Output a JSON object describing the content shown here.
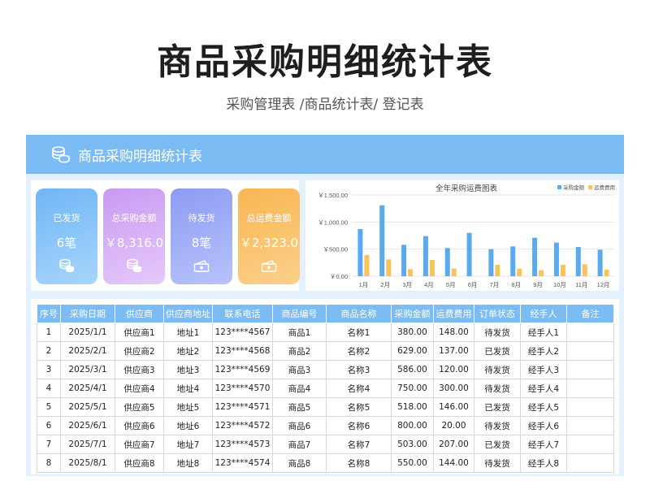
{
  "title": "商品采购明细统计表",
  "subtitle": "采购管理表 /商品统计表/ 登记表",
  "panel": {
    "header_title": "商品采购明细统计表",
    "header_icon": "coins-icon",
    "accent": "#7cbcf5"
  },
  "cards": [
    {
      "label": "已发货",
      "value": "6笔",
      "icon": "coins-icon",
      "color": "#6fb6f5"
    },
    {
      "label": "总采购金额",
      "value": "￥8,316.0",
      "icon": "coins-icon",
      "color": "#c89af2"
    },
    {
      "label": "待发货",
      "value": "8笔",
      "icon": "money-bill-icon",
      "color": "#8c9cf3"
    },
    {
      "label": "总运费金额",
      "value": "￥2,323.0",
      "icon": "money-bill-icon",
      "color": "#f9b651"
    }
  ],
  "chart_data": {
    "type": "bar",
    "title": "全年采购运费图表",
    "categories": [
      "1月",
      "2月",
      "3月",
      "4月",
      "5月",
      "6月",
      "7月",
      "8月",
      "9月",
      "10月",
      "11月",
      "12月"
    ],
    "series": [
      {
        "name": "采购金额",
        "color": "#5aaaf0",
        "values": [
          870,
          1310,
          580,
          740,
          520,
          800,
          500,
          550,
          710,
          620,
          540,
          490
        ]
      },
      {
        "name": "运费费用",
        "color": "#f8c35a",
        "values": [
          390,
          310,
          130,
          300,
          140,
          0,
          210,
          140,
          110,
          210,
          220,
          120
        ]
      }
    ],
    "y_ticks": [
      "￥1,500.00",
      "￥1,000.00",
      "￥500.00",
      "￥0.00"
    ],
    "ylim": [
      0,
      1500
    ],
    "legend_position": "top-right"
  },
  "table": {
    "headers": [
      "序号",
      "采购日期",
      "供应商",
      "供应商地址",
      "联系电话",
      "商品编号",
      "商品名称",
      "采购金额",
      "运费费用",
      "订单状态",
      "经手人",
      "备注"
    ],
    "rows": [
      [
        "1",
        "2025/1/1",
        "供应商1",
        "地址1",
        "123****4567",
        "商品1",
        "名称1",
        "380.00",
        "148.00",
        "待发货",
        "经手人1",
        ""
      ],
      [
        "2",
        "2025/2/1",
        "供应商2",
        "地址2",
        "123****4568",
        "商品2",
        "名称2",
        "629.00",
        "137.00",
        "已发货",
        "经手人2",
        ""
      ],
      [
        "3",
        "2025/3/1",
        "供应商3",
        "地址3",
        "123****4569",
        "商品3",
        "名称3",
        "586.00",
        "120.00",
        "待发货",
        "经手人3",
        ""
      ],
      [
        "4",
        "2025/4/1",
        "供应商4",
        "地址4",
        "123****4570",
        "商品4",
        "名称4",
        "750.00",
        "300.00",
        "待发货",
        "经手人4",
        ""
      ],
      [
        "5",
        "2025/5/1",
        "供应商5",
        "地址5",
        "123****4571",
        "商品5",
        "名称5",
        "518.00",
        "146.00",
        "已发货",
        "经手人5",
        ""
      ],
      [
        "6",
        "2025/6/1",
        "供应商6",
        "地址6",
        "123****4572",
        "商品6",
        "名称6",
        "800.00",
        "20.00",
        "待发货",
        "经手人6",
        ""
      ],
      [
        "7",
        "2025/7/1",
        "供应商7",
        "地址7",
        "123****4573",
        "商品7",
        "名称7",
        "503.00",
        "207.00",
        "已发货",
        "经手人7",
        ""
      ],
      [
        "8",
        "2025/8/1",
        "供应商8",
        "地址8",
        "123****4574",
        "商品8",
        "名称8",
        "550.00",
        "144.00",
        "待发货",
        "经手人8",
        ""
      ]
    ]
  }
}
